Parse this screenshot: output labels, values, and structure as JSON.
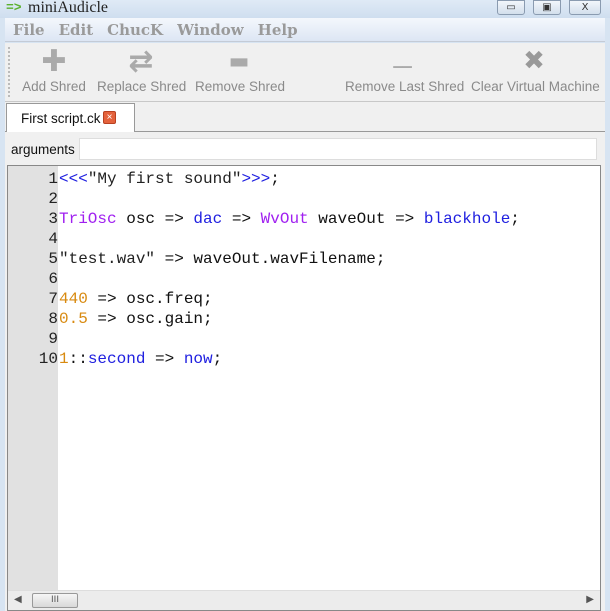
{
  "window": {
    "title": "miniAudicle",
    "logo": "=>",
    "minimize": "▭",
    "maximize": "▣",
    "close": "X"
  },
  "menu": [
    "File",
    "Edit",
    "ChucK",
    "Window",
    "Help"
  ],
  "toolbar": [
    {
      "label": "Add Shred",
      "icon": "plus-icon",
      "glyph": "✚"
    },
    {
      "label": "Replace Shred",
      "icon": "replace-arrows-icon",
      "glyph": "⇄"
    },
    {
      "label": "Remove Shred",
      "icon": "minus-icon",
      "glyph": "▬"
    },
    {
      "label": "Remove Last Shred",
      "icon": "remove-last-icon",
      "glyph": "▁▁"
    },
    {
      "label": "Clear Virtual Machine",
      "icon": "x-icon",
      "glyph": "✖"
    }
  ],
  "tab": {
    "label": "First script.ck",
    "close": "×"
  },
  "arguments": {
    "label": "arguments",
    "value": ""
  },
  "colors": {
    "ugen": "#a020f0",
    "keyword": "#2020e0",
    "number": "#d88a10"
  },
  "code": [
    [
      [
        "<<<",
        "kw"
      ],
      [
        "\"My first sound\"",
        "str"
      ],
      [
        ">>>",
        "kw"
      ],
      [
        ";",
        "plain"
      ]
    ],
    [],
    [
      [
        "TriOsc",
        "ugen"
      ],
      [
        " osc => ",
        "plain"
      ],
      [
        "dac",
        "kw"
      ],
      [
        " => ",
        "plain"
      ],
      [
        "WvOut",
        "ugen"
      ],
      [
        " waveOut => ",
        "plain"
      ],
      [
        "blackhole",
        "kw"
      ],
      [
        ";",
        "plain"
      ]
    ],
    [],
    [
      [
        "\"test.wav\"",
        "str"
      ],
      [
        " => waveOut.wavFilename;",
        "plain"
      ]
    ],
    [],
    [
      [
        "440",
        "num"
      ],
      [
        " => osc.freq;",
        "plain"
      ]
    ],
    [
      [
        "0.5",
        "num"
      ],
      [
        " => osc.gain;",
        "plain"
      ]
    ],
    [],
    [
      [
        "1",
        "num"
      ],
      [
        "::",
        "plain"
      ],
      [
        "second",
        "kw"
      ],
      [
        " => ",
        "plain"
      ],
      [
        "now",
        "kw"
      ],
      [
        ";",
        "plain"
      ]
    ]
  ],
  "scrollbar": {
    "left": "◀",
    "right": "▶",
    "grip": "III"
  }
}
